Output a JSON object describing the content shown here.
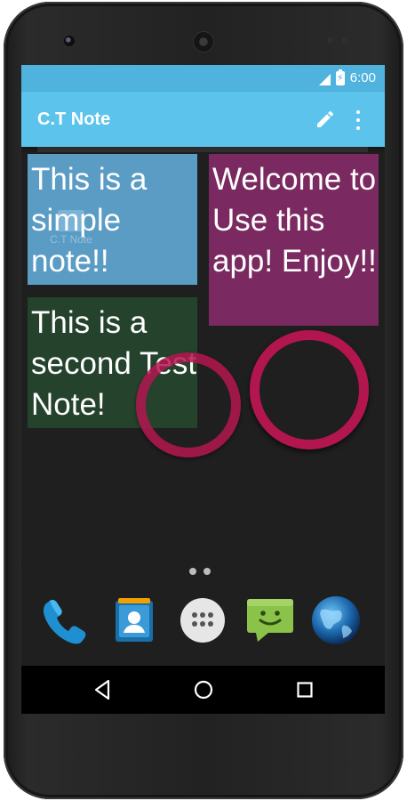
{
  "status_bar": {
    "time": "6:00",
    "icons": [
      "signal-icon",
      "battery-charging-icon"
    ],
    "color": "#4fb3dd"
  },
  "app_bar": {
    "title": "C.T Note",
    "actions": [
      "edit-pencil-icon",
      "overflow-menu-icon"
    ],
    "color": "#5cc4ec"
  },
  "notes": [
    {
      "text": "This is a simple note!!",
      "color": "#5b9cc4"
    },
    {
      "text": "Welcome to Use this app! Enjoy!!",
      "color": "#7a2a60"
    },
    {
      "text": "This is a second Test Note!",
      "color": "#24422c"
    }
  ],
  "ghost_shortcut": {
    "label": "C.T Note",
    "icon": "app-icon"
  },
  "ring_color": "#b3164f",
  "home_page_indicator": {
    "pages": 2
  },
  "dock": {
    "items": [
      "phone-icon",
      "contacts-icon",
      "app-drawer-icon",
      "messaging-icon",
      "browser-icon"
    ]
  },
  "nav_bar": {
    "buttons": [
      "back-icon",
      "home-icon",
      "recents-icon"
    ]
  }
}
